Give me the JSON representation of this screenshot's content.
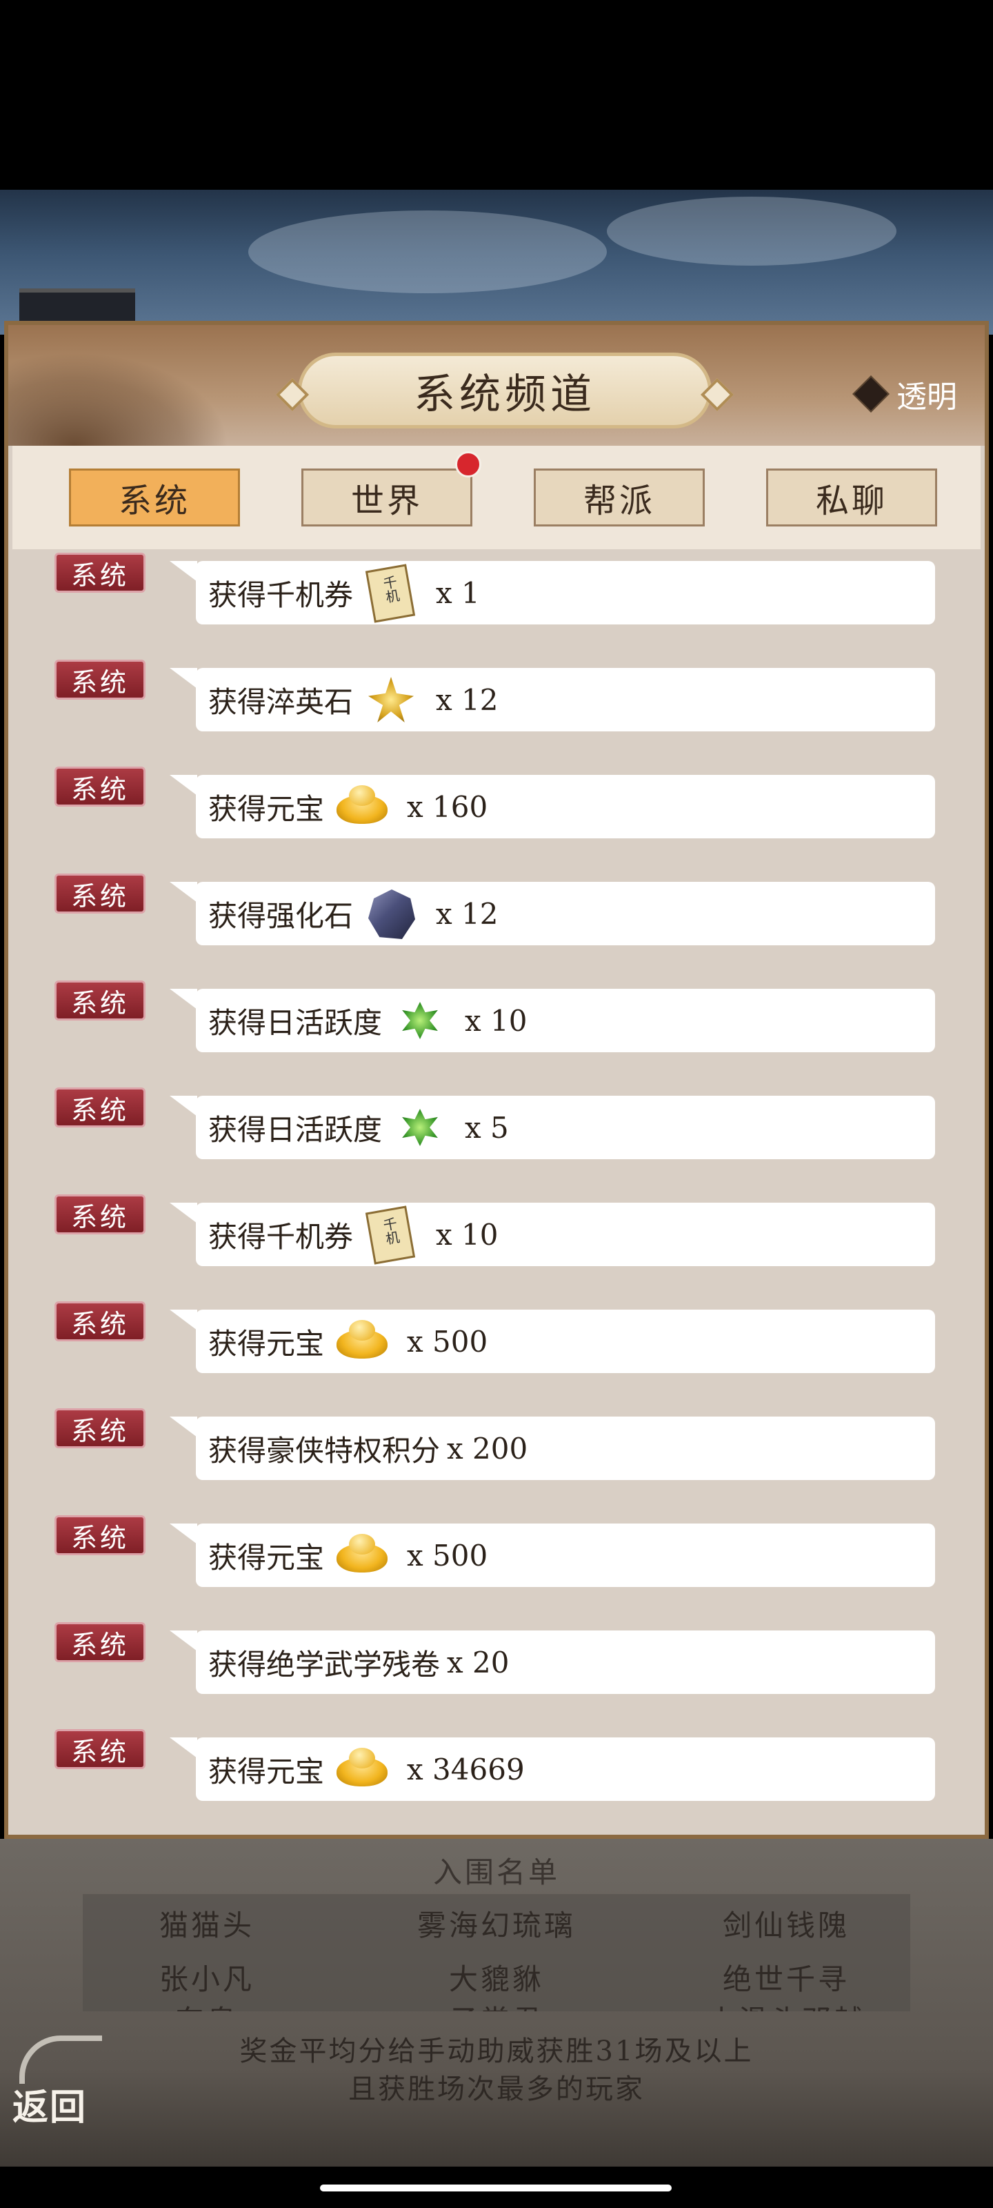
{
  "header": {
    "title": "系统频道",
    "transparent_label": "透明"
  },
  "tabs": [
    {
      "label": "系统",
      "active": true,
      "notification": false
    },
    {
      "label": "世界",
      "active": false,
      "notification": true
    },
    {
      "label": "帮派",
      "active": false,
      "notification": false
    },
    {
      "label": "私聊",
      "active": false,
      "notification": false
    }
  ],
  "messages": [
    {
      "badge": "系统",
      "text": "获得千机券",
      "icon": "ticket-icon",
      "quantity": "x 1"
    },
    {
      "badge": "系统",
      "text": "获得淬英石",
      "icon": "crystal-icon",
      "quantity": "x 12"
    },
    {
      "badge": "系统",
      "text": "获得元宝",
      "icon": "gold-ingot-icon",
      "quantity": "x 160"
    },
    {
      "badge": "系统",
      "text": "获得强化石",
      "icon": "stone-icon",
      "quantity": "x 12"
    },
    {
      "badge": "系统",
      "text": "获得日活跃度",
      "icon": "activity-icon",
      "quantity": "x 10"
    },
    {
      "badge": "系统",
      "text": "获得日活跃度",
      "icon": "activity-icon",
      "quantity": "x 5"
    },
    {
      "badge": "系统",
      "text": "获得千机券",
      "icon": "ticket-icon",
      "quantity": "x 10"
    },
    {
      "badge": "系统",
      "text": "获得元宝",
      "icon": "gold-ingot-icon",
      "quantity": "x 500"
    },
    {
      "badge": "系统",
      "text": "获得豪侠特权积分",
      "icon": "",
      "quantity": "x 200"
    },
    {
      "badge": "系统",
      "text": "获得元宝",
      "icon": "gold-ingot-icon",
      "quantity": "x 500"
    },
    {
      "badge": "系统",
      "text": "获得绝学武学残卷",
      "icon": "",
      "quantity": "x 20"
    },
    {
      "badge": "系统",
      "text": "获得元宝",
      "icon": "gold-ingot-icon",
      "quantity": "x 34669"
    }
  ],
  "shortlist": {
    "title": "入围名单",
    "names": [
      "猫猫头",
      "雾海幻琉璃",
      "剑仙钱隗",
      "张小凡",
      "大貔貅",
      "绝世千寻",
      "东皇",
      "子棠君",
      "小滑头邓越"
    ]
  },
  "note": {
    "line1": "奖金平均分给手动助威获胜31场及以上",
    "line2": "且获胜场次最多的玩家"
  },
  "back_label": "返回",
  "colors": {
    "active_tab": "#f2b05a",
    "badge": "#9a2f37",
    "panel": "#d9cfc5",
    "notification_dot": "#d7262d"
  }
}
